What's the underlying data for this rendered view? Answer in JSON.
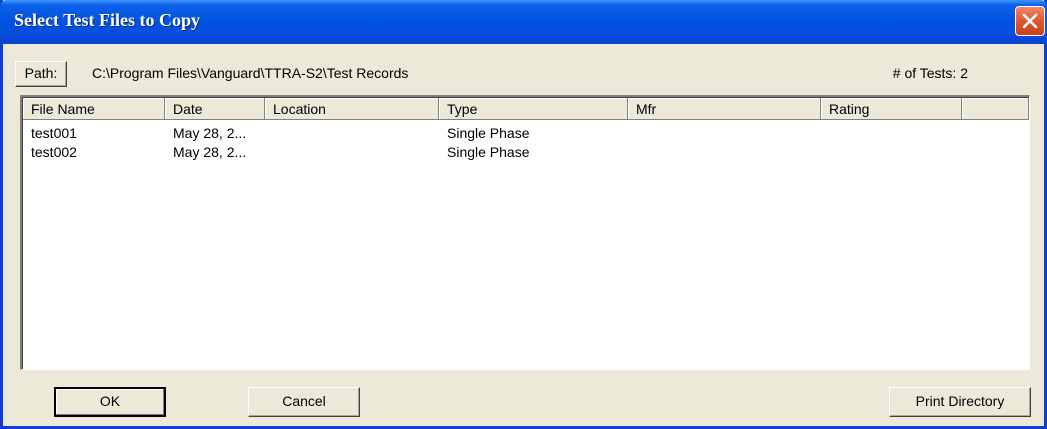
{
  "window": {
    "title": "Select Test Files to Copy"
  },
  "path": {
    "button_label": "Path:",
    "value": "C:\\Program Files\\Vanguard\\TTRA-S2\\Test Records"
  },
  "test_count": {
    "label": "# of Tests: 2"
  },
  "table": {
    "columns": [
      "File Name",
      "Date",
      "Location",
      "Type",
      "Mfr",
      "Rating",
      ""
    ],
    "rows": [
      [
        "test001",
        "May 28, 2...",
        "",
        "Single Phase",
        "",
        ""
      ],
      [
        "test002",
        "May 28, 2...",
        "",
        "Single Phase",
        "",
        ""
      ]
    ]
  },
  "buttons": {
    "ok": "OK",
    "cancel": "Cancel",
    "print_directory": "Print Directory"
  },
  "icons": {
    "close": "close-icon"
  },
  "colors": {
    "titlebar": "#0053e0",
    "close_button": "#e0562e",
    "dialog_background": "#ece9d8"
  }
}
